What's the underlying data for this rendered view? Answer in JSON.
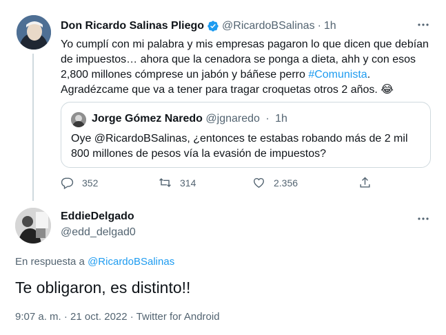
{
  "tweet": {
    "author_name": "Don Ricardo Salinas Pliego",
    "author_handle": "@RicardoBSalinas",
    "time": "1h",
    "text_lines": [
      "Yo cumplí con mi palabra y mis empresas pagaron lo que dicen que debían",
      "de impuestos… ahora que la cenadora se ponga a dieta, ahh y con esos",
      "2,800 millones cómprese un jabón y báñese perro ",
      "Agradézcame que va a tener para tragar croquetas otros 2 años. 😂"
    ],
    "hashtag": "#Comunista",
    "hashtag_suffix": ".",
    "quoted": {
      "author_name": "Jorge Gómez Naredo",
      "author_handle": "@jgnaredo",
      "time": "1h",
      "text_lines": [
        "Oye @RicardoBSalinas, ¿entonces te estabas robando más de 2 mil",
        "800 millones de pesos vía la evasión de impuestos?"
      ]
    },
    "counts": {
      "replies": "352",
      "retweets": "314",
      "likes": "2.356"
    }
  },
  "reply": {
    "author_name": "EddieDelgado",
    "author_handle": "@edd_delgad0",
    "reply_prefix": "En respuesta a",
    "reply_to": "@RicardoBSalinas",
    "text": "Te obligaron, es distinto!!",
    "meta": "9:07 a. m. · 21 oct. 2022 · Twitter for Android"
  },
  "separator": "·",
  "colors": {
    "accent": "#1d9bf0",
    "muted": "#536471",
    "text": "#0f1419",
    "border": "#cfd9de"
  },
  "icons": [
    "verified-badge-icon",
    "more-icon",
    "reply-icon",
    "retweet-icon",
    "like-icon",
    "share-icon"
  ]
}
